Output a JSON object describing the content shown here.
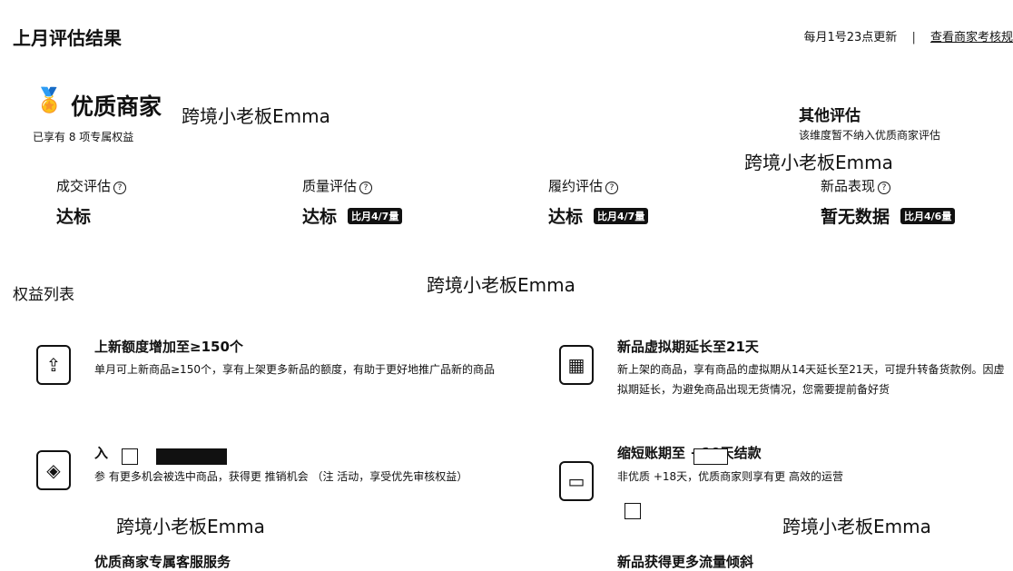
{
  "header": {
    "title": "上月评估结果",
    "update_note": "每月1号23点更新",
    "separator": "|",
    "view_link": "查看商家考核规"
  },
  "tier": {
    "icon": "medal-icon",
    "name": "优质商家",
    "rights_count": "已享有 8 项专属权益"
  },
  "other_eval": {
    "title": "其他评估",
    "desc": "该维度暂不纳入优质商家评估"
  },
  "watermark": "跨境小老板Emma",
  "metrics": [
    {
      "label": "成交评估",
      "value": "达标",
      "badge": ""
    },
    {
      "label": "质量评估",
      "value": "达标",
      "badge": "比月4/7量"
    },
    {
      "label": "履约评估",
      "value": "达标",
      "badge": "比月4/7量"
    },
    {
      "label": "新品表现",
      "value": "暂无数据",
      "badge": "比月4/6量"
    }
  ],
  "benefits_section": "权益列表",
  "benefits": [
    {
      "icon": "new-listing-icon",
      "title": "上新额度增加至≥150个",
      "desc": "单月可上新商品≥150个，享有上架更多新品的额度，有助于更好地推广品新的商品"
    },
    {
      "icon": "calendar-icon",
      "title": "新品虚拟期延长至21天",
      "desc": "新上架的商品，享有商品的虚拟期从14天延长至21天，可提升转备货款例。因虚拟期延长，为避免商品出现无货情况，您需要提前备好货"
    },
    {
      "icon": "shield-icon",
      "title": "入",
      "desc": "参 有更多机会被选中商品，获得更 推销机会 （注 活动，享受优先审核权益）"
    },
    {
      "icon": "wallet-icon",
      "title": "缩短账期至 +10天结款",
      "desc": "非优质 +18天，优质商家则享有更 高效的运营"
    },
    {
      "icon": "headset-icon",
      "title": "优质商家专属客服服务",
      "desc": ""
    },
    {
      "icon": "traffic-icon",
      "title": "新品获得更多流量倾斜",
      "desc": ""
    }
  ]
}
